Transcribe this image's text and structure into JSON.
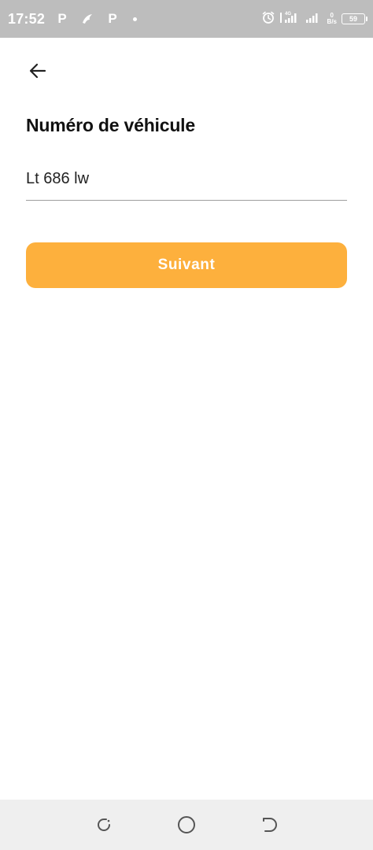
{
  "status_bar": {
    "time": "17:52",
    "app_icons": [
      "P",
      "P"
    ],
    "network": "4G",
    "battery": "59",
    "speed_top": "0",
    "speed_bottom": "B/s"
  },
  "page": {
    "title": "Numéro de véhicule"
  },
  "vehicle_input": {
    "value": "Lt 686 lw"
  },
  "next_button": {
    "label": "Suivant"
  },
  "colors": {
    "accent": "#fdb03d",
    "status_bar_bg": "#bdbdbd",
    "nav_bar_bg": "#efefef"
  },
  "icons": {
    "back": "arrow-left-icon",
    "alarm": "alarm-icon",
    "signal": "signal-icon",
    "recent": "recent-apps-icon",
    "home": "home-icon",
    "nav_back": "nav-back-icon"
  }
}
